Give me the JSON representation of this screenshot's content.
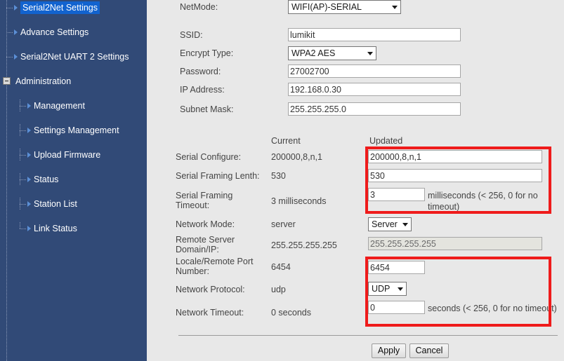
{
  "sidebar": {
    "background_color": "#314a77",
    "selected_color": "#1263cf",
    "items": [
      {
        "label": "Serial2Net Settings",
        "level": 1,
        "icon": "arrow-right-icon",
        "selected": true
      },
      {
        "label": "Advance Settings",
        "level": 1,
        "icon": "arrow-right-icon",
        "selected": false
      },
      {
        "label": "Serial2Net UART 2 Settings",
        "level": 1,
        "icon": "arrow-right-icon",
        "selected": false
      },
      {
        "label": "Administration",
        "level": 1,
        "icon": "minus-box-icon",
        "selected": false
      },
      {
        "label": "Management",
        "level": 2,
        "icon": "arrow-right-icon",
        "selected": false
      },
      {
        "label": "Settings Management",
        "level": 2,
        "icon": "arrow-right-icon",
        "selected": false
      },
      {
        "label": "Upload Firmware",
        "level": 2,
        "icon": "arrow-right-icon",
        "selected": false
      },
      {
        "label": "Status",
        "level": 2,
        "icon": "arrow-right-icon",
        "selected": false
      },
      {
        "label": "Station List",
        "level": 2,
        "icon": "arrow-right-icon",
        "selected": false
      },
      {
        "label": "Link Status",
        "level": 2,
        "icon": "arrow-right-icon",
        "selected": false
      }
    ]
  },
  "network_form": {
    "netmode": {
      "label": "NetMode:",
      "value": "WIFI(AP)-SERIAL",
      "control": "select"
    },
    "ssid": {
      "label": "SSID:",
      "value": "lumikit",
      "control": "text"
    },
    "encrypt_type": {
      "label": "Encrypt Type:",
      "value": "WPA2 AES",
      "control": "select"
    },
    "password": {
      "label": "Password:",
      "value": "27002700",
      "control": "text"
    },
    "ip_address": {
      "label": "IP Address:",
      "value": "192.168.0.30",
      "control": "text"
    },
    "subnet_mask": {
      "label": "Subnet Mask:",
      "value": "255.255.255.0",
      "control": "text"
    }
  },
  "serial_table": {
    "col_current": "Current",
    "col_updated": "Updated",
    "rows": [
      {
        "label": "Serial Configure:",
        "current": "200000,8,n,1",
        "updated_value": "200000,8,n,1",
        "control": "text"
      },
      {
        "label": "Serial Framing Lenth:",
        "current": "530",
        "updated_value": "530",
        "control": "text"
      },
      {
        "label": "Serial Framing Timeout:",
        "current": "3 milliseconds",
        "updated_value": "3",
        "control": "text",
        "hint": "milliseconds (< 256,  0 for no timeout)"
      },
      {
        "label": "Network Mode:",
        "current": "server",
        "updated_value": "Server",
        "control": "select"
      },
      {
        "label": "Remote Server Domain/IP:",
        "current": "255.255.255.255",
        "updated_value": "255.255.255.255",
        "control": "text",
        "disabled": true
      },
      {
        "label": "Locale/Remote Port Number:",
        "current": "6454",
        "updated_value": "6454",
        "control": "text"
      },
      {
        "label": "Network Protocol:",
        "current": "udp",
        "updated_value": "UDP",
        "control": "select"
      },
      {
        "label": "Network Timeout:",
        "current": "0 seconds",
        "updated_value": "0",
        "control": "text",
        "hint": "seconds (< 256,  0 for no timeout)"
      }
    ]
  },
  "highlights": {
    "color": "#ef1b1b",
    "boxes": [
      {
        "name": "serial-settings-highlight"
      },
      {
        "name": "network-port-highlight"
      }
    ]
  },
  "footer": {
    "apply_label": "Apply",
    "cancel_label": "Cancel"
  }
}
